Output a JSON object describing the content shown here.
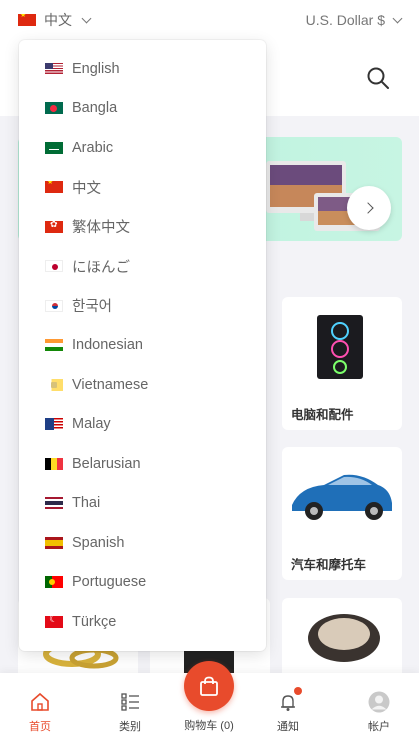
{
  "header": {
    "language": "中文",
    "language_flag": "flag-cn",
    "currency": "U.S. Dollar $"
  },
  "language_menu": {
    "items": [
      {
        "label": "English",
        "flag": "f-us"
      },
      {
        "label": "Bangla",
        "flag": "f-bd"
      },
      {
        "label": "Arabic",
        "flag": "f-sa"
      },
      {
        "label": "中文",
        "flag": "f-cn"
      },
      {
        "label": "繁体中文",
        "flag": "f-hk"
      },
      {
        "label": "にほんご",
        "flag": "f-jp"
      },
      {
        "label": "한국어",
        "flag": "f-kr"
      },
      {
        "label": "Indonesian",
        "flag": "f-in"
      },
      {
        "label": "Vietnamese",
        "flag": "f-vn"
      },
      {
        "label": "Malay",
        "flag": "f-my"
      },
      {
        "label": "Belarusian",
        "flag": "f-by"
      },
      {
        "label": "Thai",
        "flag": "f-th"
      },
      {
        "label": "Spanish",
        "flag": "f-es"
      },
      {
        "label": "Portuguese",
        "flag": "f-pt"
      },
      {
        "label": "Türkçe",
        "flag": "f-tr"
      }
    ]
  },
  "categories": {
    "computers": "电脑和配件",
    "cars": "汽车和摩托车"
  },
  "bottom_nav": {
    "home": "首页",
    "category": "类别",
    "cart": "购物车 (0)",
    "notifications": "通知",
    "account": "帐户"
  },
  "colors": {
    "accent": "#e84b2c",
    "banner": "#b8f0dc"
  }
}
